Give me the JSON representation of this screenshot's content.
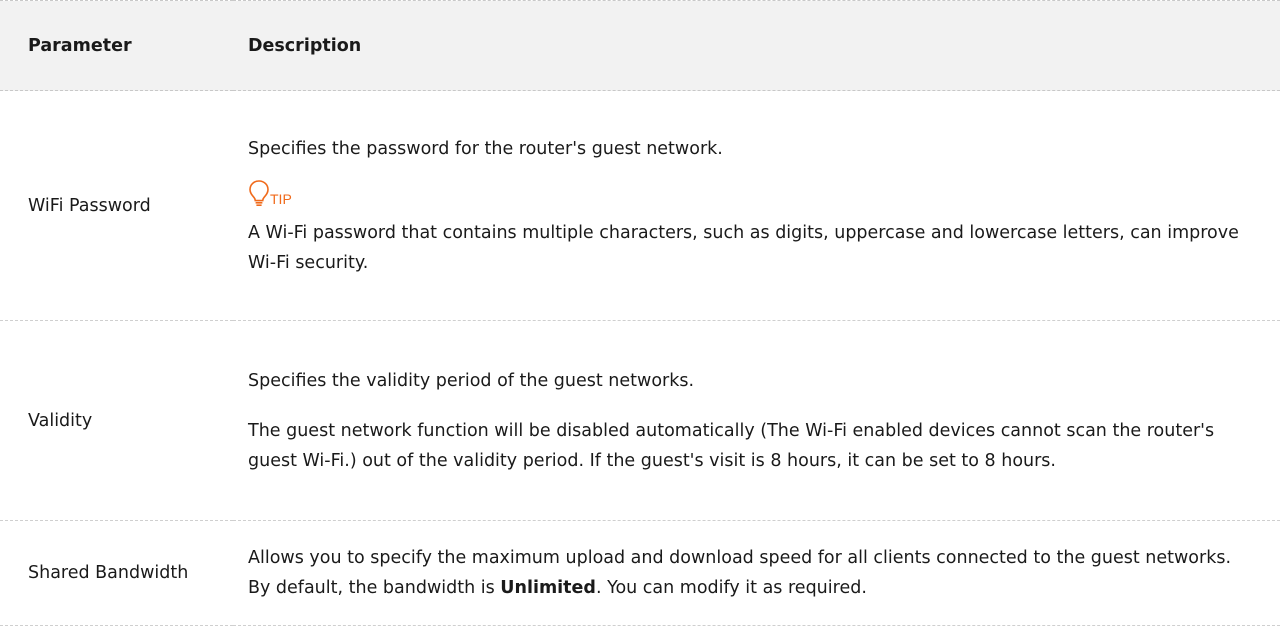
{
  "table": {
    "header": {
      "parameter": "Parameter",
      "description": "Description"
    },
    "rows": [
      {
        "parameter": "WiFi Password",
        "description_1": "Specifies the password for the router's guest network.",
        "tip_label": "TIP",
        "tip_icon": "lightbulb-icon",
        "tip_text": "A Wi-Fi password that contains multiple characters, such as digits, uppercase and lowercase letters, can improve Wi-Fi security."
      },
      {
        "parameter": "Validity",
        "description_1": "Specifies the validity period of the guest networks.",
        "description_2": "The guest network function will be disabled automatically (The Wi-Fi enabled devices cannot scan the router's guest Wi-Fi.) out of the validity period. If the guest's visit is 8 hours, it can be set to 8 hours."
      },
      {
        "parameter": "Shared Bandwidth",
        "description_before": "Allows you to specify the maximum upload and download speed for all clients connected to the guest networks. By default, the bandwidth is ",
        "description_bold": "Unlimited",
        "description_after": ". You can modify it as required."
      }
    ]
  },
  "colors": {
    "tip_accent": "#f06a1b",
    "header_background": "#f2f2f2"
  }
}
